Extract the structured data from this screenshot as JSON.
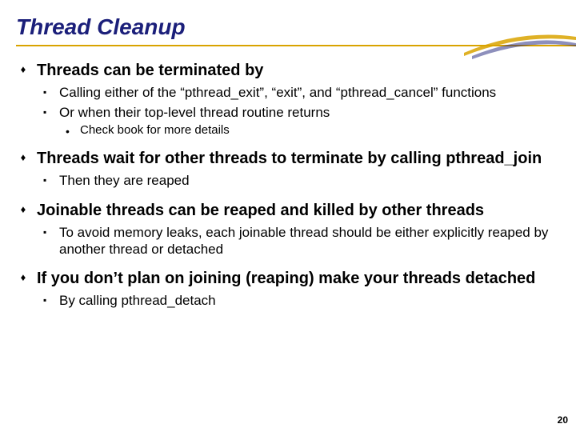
{
  "title": "Thread Cleanup",
  "bullets": {
    "b1": {
      "text": "Threads can be terminated by",
      "s1": "Calling either of the “pthread_exit”, “exit”, and “pthread_cancel” functions",
      "s2": "Or when their top-level thread routine returns",
      "s2a": "Check book for more details"
    },
    "b2": {
      "text": "Threads wait for other threads to terminate by calling pthread_join",
      "s1": "Then they are reaped"
    },
    "b3": {
      "text": "Joinable threads can be reaped and killed by other threads",
      "s1": "To avoid memory leaks, each joinable thread should be either explicitly reaped by another thread or detached"
    },
    "b4": {
      "text": "If you don’t plan on joining (reaping) make your threads detached",
      "s1": "By calling pthread_detach"
    }
  },
  "glyphs": {
    "diamond": "♦",
    "square": "▪",
    "bullet": "•"
  },
  "pagenum": "20"
}
